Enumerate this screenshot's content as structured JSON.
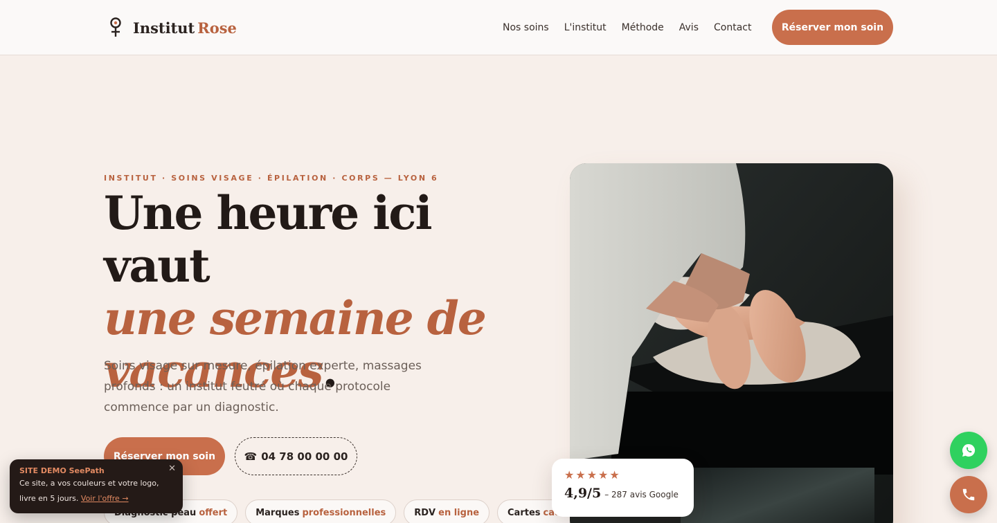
{
  "brand": {
    "name": "Institut",
    "accent": "Rose"
  },
  "nav": {
    "items": [
      "Nos soins",
      "L'institut",
      "Méthode",
      "Avis",
      "Contact"
    ],
    "cta": "Réserver mon soin"
  },
  "hero": {
    "eyebrow": "INSTITUT · SOINS VISAGE · ÉPILATION · CORPS — LYON 6",
    "title_line1": "Une heure ici vaut",
    "title_line2": "une semaine de",
    "title_line3": "vacances",
    "title_dot": ".",
    "lead": "Soins visage sur mesure, épilation experte, massages profonds : un institut feutré où chaque protocole commence par un diagnostic.",
    "cta": "Réserver mon soin",
    "phone": "04 78 00 00 00",
    "phone_icon": "☎"
  },
  "chips": [
    {
      "text": "Diagnostic peau",
      "accent": "offert"
    },
    {
      "text": "Marques",
      "accent": "professionnelles"
    },
    {
      "text": "RDV",
      "accent": "en ligne"
    },
    {
      "text": "Cartes",
      "accent": "cadeaux"
    }
  ],
  "rating": {
    "stars": "★★★★★",
    "score": "4,9/5",
    "text": "– 287 avis Google"
  },
  "toast": {
    "title": "SITE DEMO SeePath",
    "body": "Ce site, a vos couleurs et votre logo, livre en 5 jours.",
    "link": "Voir l'offre →",
    "close": "✕"
  },
  "colors": {
    "accent": "#c96f4c",
    "text_accent": "#b8623f",
    "background": "#f7efea",
    "whatsapp": "#2fd15f"
  },
  "icons": {
    "brand": "female-symbol-icon",
    "whatsapp": "whatsapp-icon",
    "phone": "phone-icon"
  }
}
